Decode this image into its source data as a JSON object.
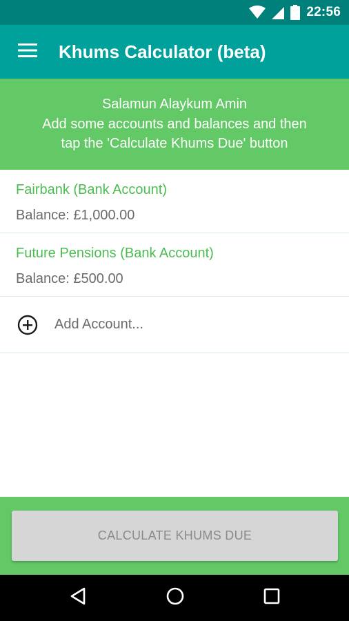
{
  "status_bar": {
    "time": "22:56",
    "icons": [
      "wifi-icon",
      "cellular-signal-icon",
      "battery-icon"
    ]
  },
  "app_bar": {
    "menu_icon": "hamburger-menu-icon",
    "title": "Khums Calculator (beta)"
  },
  "banner": {
    "greeting": "Salamun Alaykum Amin",
    "instruction_line1": "Add some accounts and balances and then",
    "instruction_line2": "tap the 'Calculate Khums Due' button"
  },
  "accounts": [
    {
      "name": "Fairbank (Bank Account)",
      "balance": "Balance: £1,000.00"
    },
    {
      "name": "Future Pensions (Bank Account)",
      "balance": "Balance: £500.00"
    }
  ],
  "add_account": {
    "icon": "add-circle-icon",
    "label": "Add Account..."
  },
  "calculate_button": {
    "label": "CALCULATE KHUMS DUE"
  },
  "nav_bar": {
    "icons": [
      "back-icon",
      "home-icon",
      "recents-icon"
    ]
  },
  "colors": {
    "status_bar": "#00807a",
    "app_bar": "#00a19a",
    "banner": "#62c966",
    "account_name": "#4cbc52",
    "text_secondary": "#6b6b6b",
    "button_disabled": "#d6d6d6"
  }
}
